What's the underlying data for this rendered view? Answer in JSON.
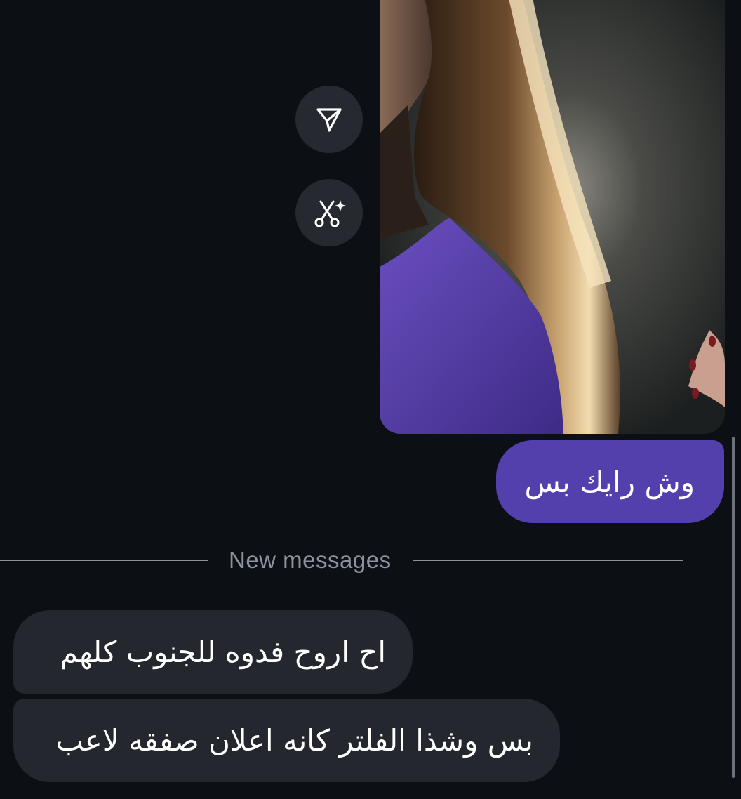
{
  "conversation": {
    "actions": {
      "share_icon": "send-triangle-icon",
      "remix_icon": "scissors-sparkle-icon"
    },
    "outgoing": {
      "text": "وش رايك بس"
    },
    "divider": {
      "label": "New messages"
    },
    "incoming": [
      {
        "text": "اح اروح فدوه للجنوب كلهم"
      },
      {
        "text": "بس وشذا الفلتر كانه اعلان صفقه لاعب"
      }
    ]
  },
  "colors": {
    "background": "#0c0f14",
    "outgoing_bubble": "#5340ad",
    "incoming_bubble": "#24272d",
    "action_button": "#262a30",
    "divider": "#8d939d"
  }
}
